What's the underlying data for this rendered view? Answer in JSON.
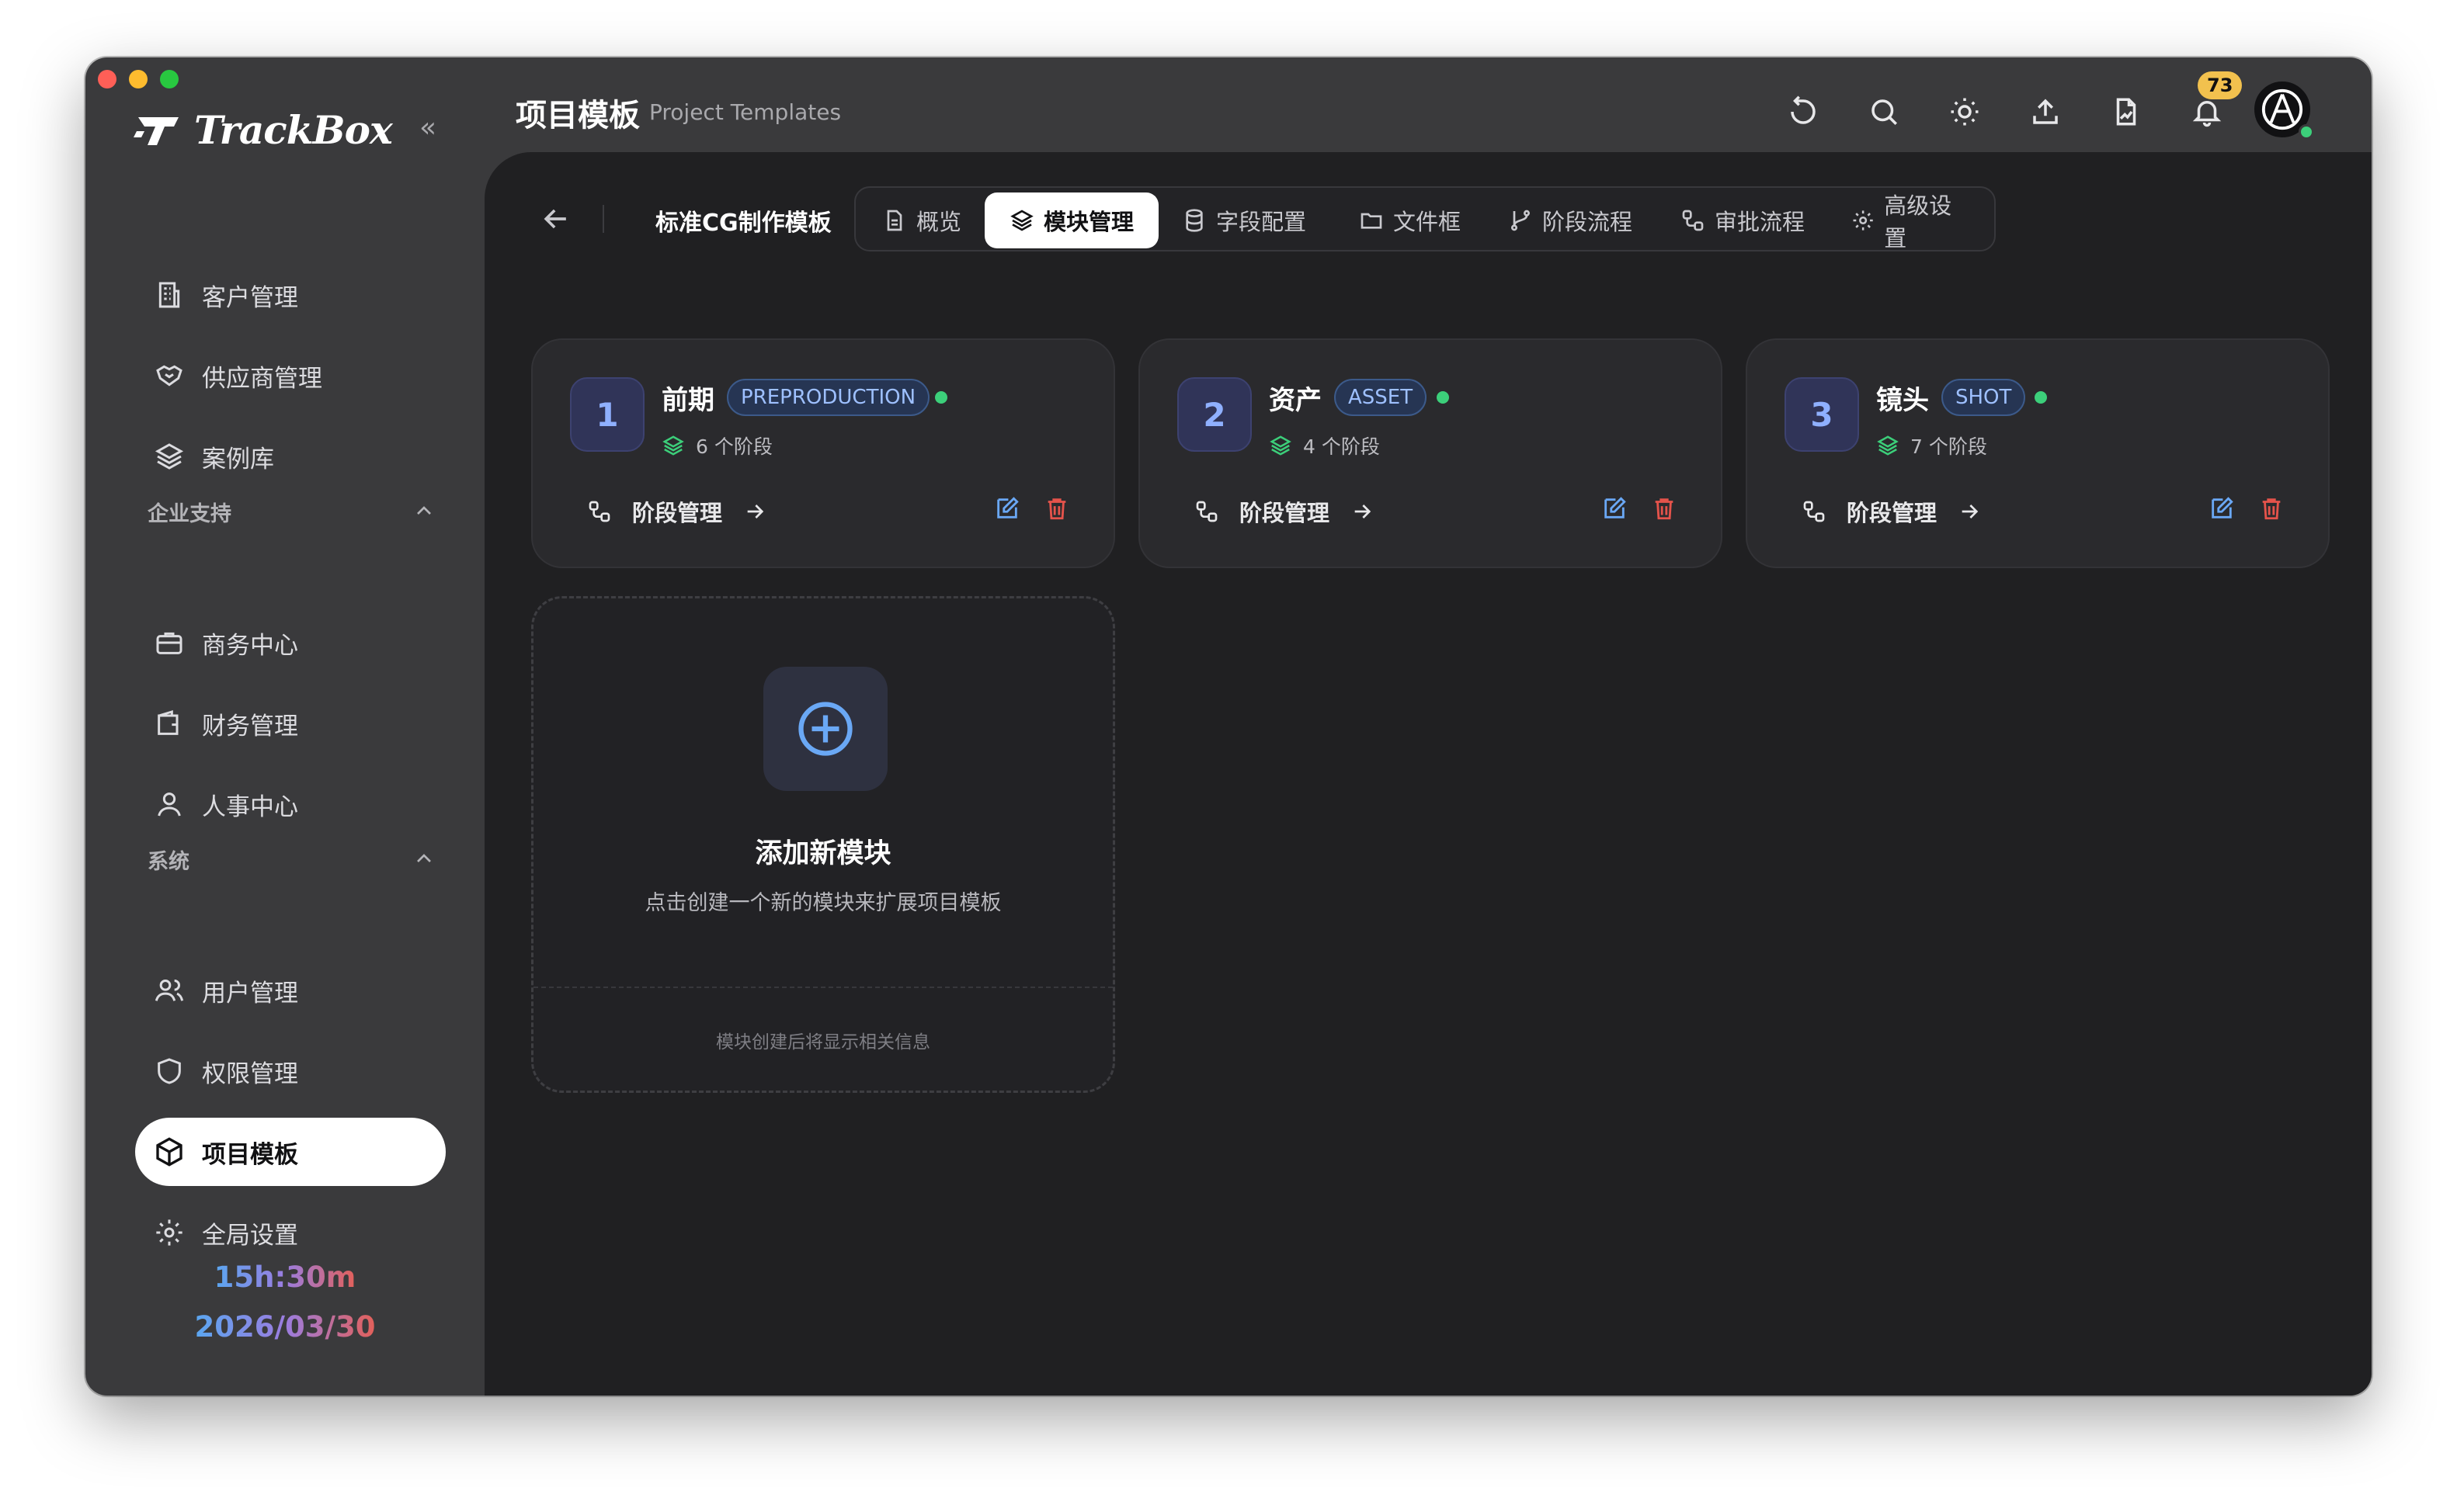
{
  "app": {
    "logo_text": "TrackBox",
    "collapse_glyph": "«"
  },
  "header": {
    "title": "项目模板",
    "subtitle": "Project Templates",
    "notification_count": "73",
    "icons": [
      "refresh-icon",
      "search-icon",
      "sun-icon",
      "upload-icon",
      "file-signature-icon",
      "bell-icon"
    ]
  },
  "sidebar": {
    "items_top": [
      {
        "label": "客户管理",
        "icon": "building-icon"
      },
      {
        "label": "供应商管理",
        "icon": "handshake-icon"
      },
      {
        "label": "案例库",
        "icon": "layers-icon"
      }
    ],
    "section_enterprise": "企业支持",
    "items_enterprise": [
      {
        "label": "商务中心",
        "icon": "briefcase-icon"
      },
      {
        "label": "财务管理",
        "icon": "wallet-icon"
      },
      {
        "label": "人事中心",
        "icon": "user-icon"
      }
    ],
    "section_system": "系统",
    "items_system": [
      {
        "label": "用户管理",
        "icon": "users-icon"
      },
      {
        "label": "权限管理",
        "icon": "shield-icon"
      },
      {
        "label": "项目模板",
        "icon": "box-icon",
        "active": true
      },
      {
        "label": "全局设置",
        "icon": "gear-icon"
      }
    ],
    "clock_time": "15h:30m",
    "clock_date": "2026/03/30"
  },
  "template": {
    "name": "标准CG制作模板",
    "tabs": [
      {
        "label": "概览"
      },
      {
        "label": "模块管理",
        "active": true
      },
      {
        "label": "字段配置"
      },
      {
        "label": "文件框"
      },
      {
        "label": "阶段流程"
      },
      {
        "label": "审批流程"
      },
      {
        "label": "高级设置"
      }
    ]
  },
  "modules": [
    {
      "index": "1",
      "name": "前期",
      "code": "PREPRODUCTION",
      "stages": "6 个阶段",
      "action": "阶段管理"
    },
    {
      "index": "2",
      "name": "资产",
      "code": "ASSET",
      "stages": "4 个阶段",
      "action": "阶段管理"
    },
    {
      "index": "3",
      "name": "镜头",
      "code": "SHOT",
      "stages": "7 个阶段",
      "action": "阶段管理"
    }
  ],
  "add_module": {
    "title": "添加新模块",
    "description": "点击创建一个新的模块来扩展项目模板",
    "footer": "模块创建后将显示相关信息"
  },
  "colors": {
    "accent_blue": "#6aa8f5",
    "online_green": "#3ccf7a",
    "delete_red": "#e5534b",
    "badge_yellow": "#f2c14e"
  }
}
